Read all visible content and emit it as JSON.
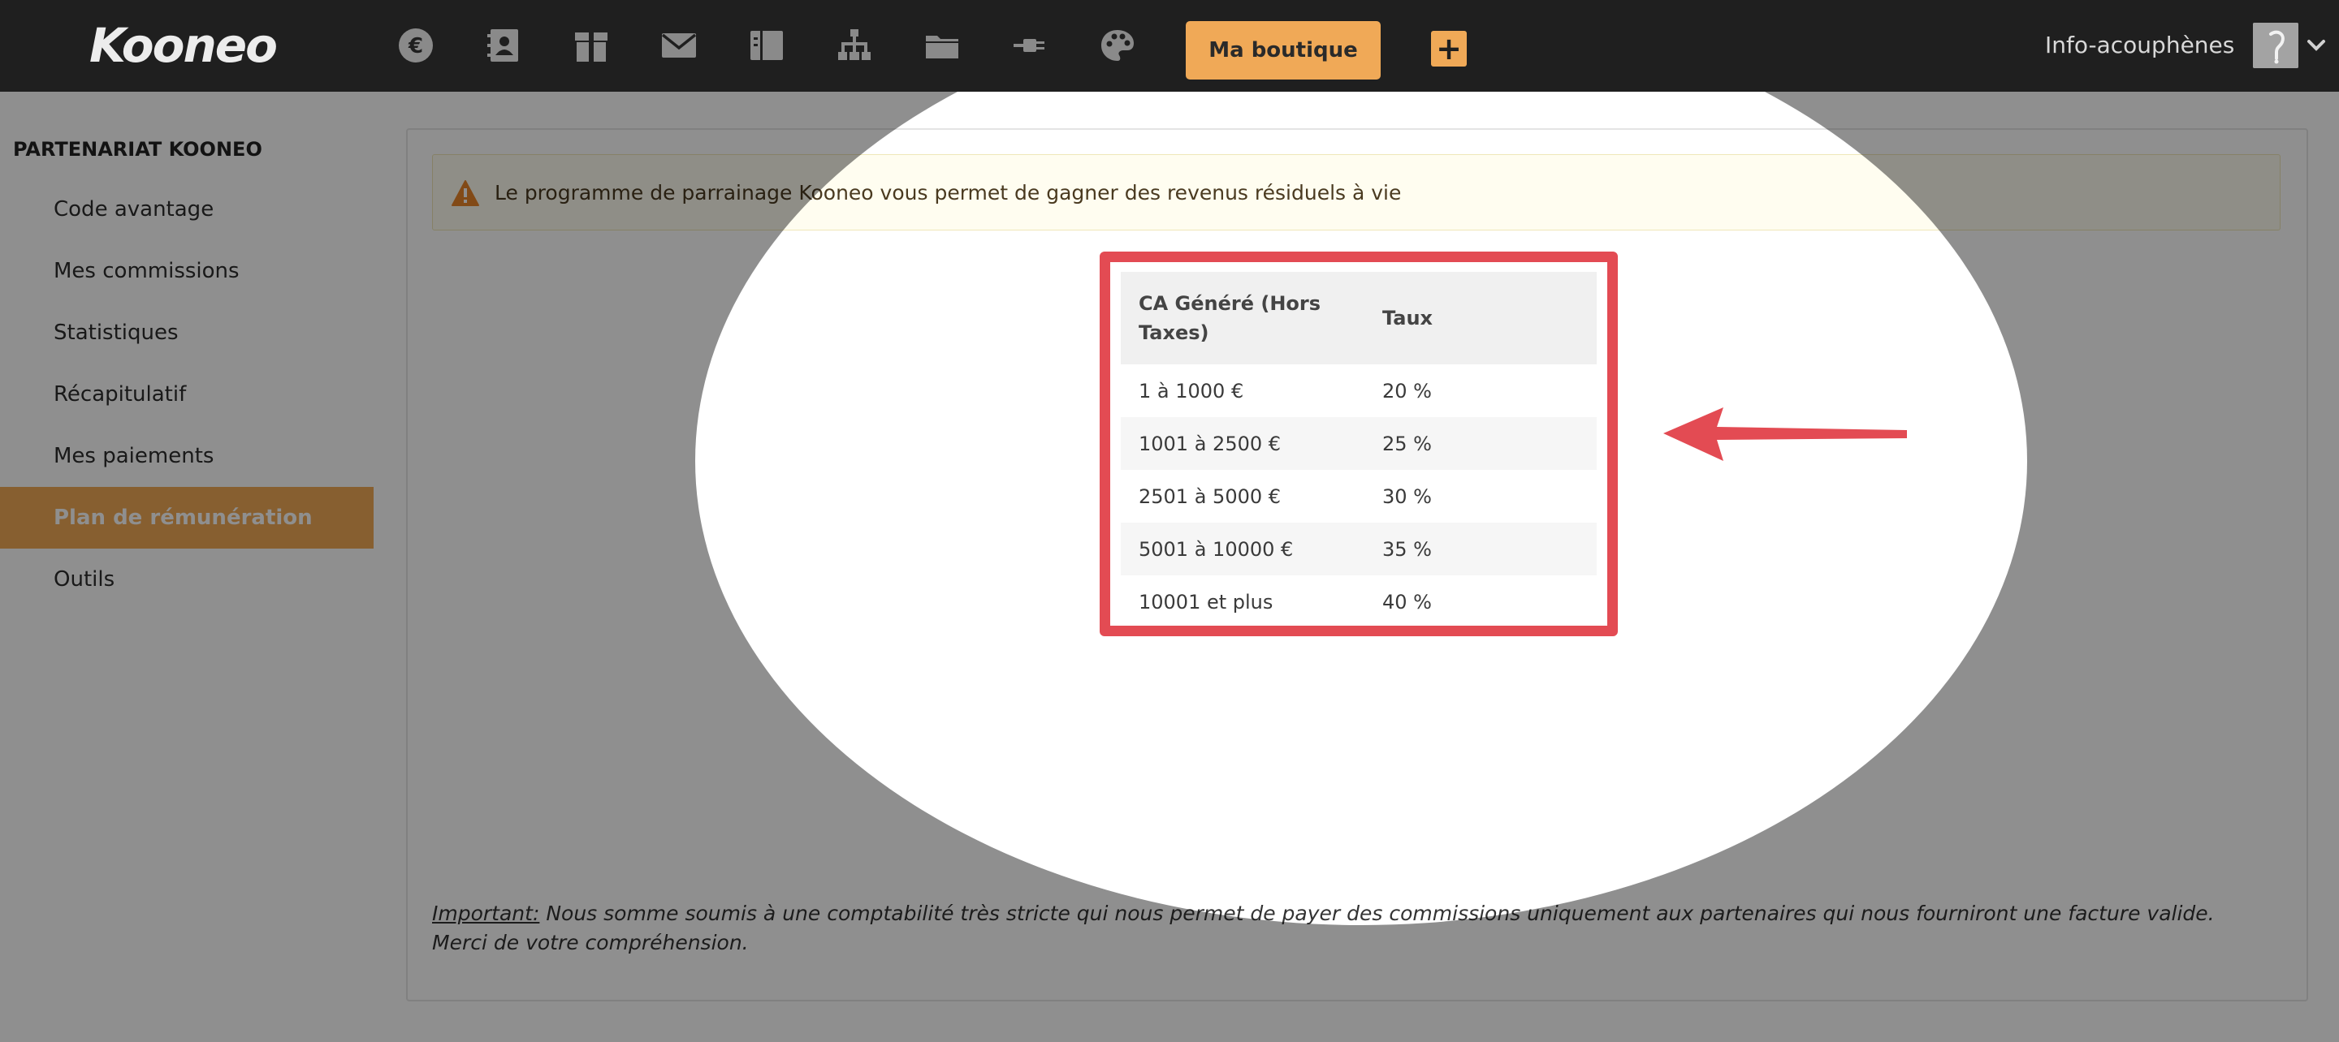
{
  "header": {
    "logo": "Kooneo",
    "nav_icons": [
      "euro-icon",
      "contacts-icon",
      "products-icon",
      "mail-icon",
      "pages-icon",
      "affiliate-tree-icon",
      "folder-icon",
      "plugin-icon",
      "palette-icon"
    ],
    "shop_button": "Ma boutique",
    "plus_button": "+",
    "user_name": "Info-acouphènes"
  },
  "sidebar": {
    "title": "PARTENARIAT KOONEO",
    "items": [
      {
        "label": "Code avantage",
        "active": false
      },
      {
        "label": "Mes commissions",
        "active": false
      },
      {
        "label": "Statistiques",
        "active": false
      },
      {
        "label": "Récapitulatif",
        "active": false
      },
      {
        "label": "Mes paiements",
        "active": false
      },
      {
        "label": "Plan de rémunération",
        "active": true
      },
      {
        "label": "Outils",
        "active": false
      }
    ]
  },
  "main": {
    "alert_text": "Le programme de parrainage Kooneo vous permet de gagner des revenus résiduels à vie",
    "table": {
      "headers": [
        "CA Généré (Hors Taxes)",
        "Taux"
      ],
      "rows": [
        [
          "1 à 1000 €",
          "20 %"
        ],
        [
          "1001 à 2500 €",
          "25 %"
        ],
        [
          "2501 à 5000 €",
          "30 %"
        ],
        [
          "5001 à 10000 €",
          "35 %"
        ],
        [
          "10001 et plus",
          "40 %"
        ]
      ]
    },
    "note_important": "Important:",
    "note_line1": " Nous somme soumis à une comptabilité très stricte qui nous permet de payer des commissions uniquement aux partenaires qui nous fourniront une facture valide.",
    "note_line2": "Merci de votre compréhension."
  },
  "colors": {
    "topbar": "#1f1f1f",
    "accent": "#f0a957",
    "highlight_red": "#e34b53",
    "dim": "#8f8f8f"
  }
}
